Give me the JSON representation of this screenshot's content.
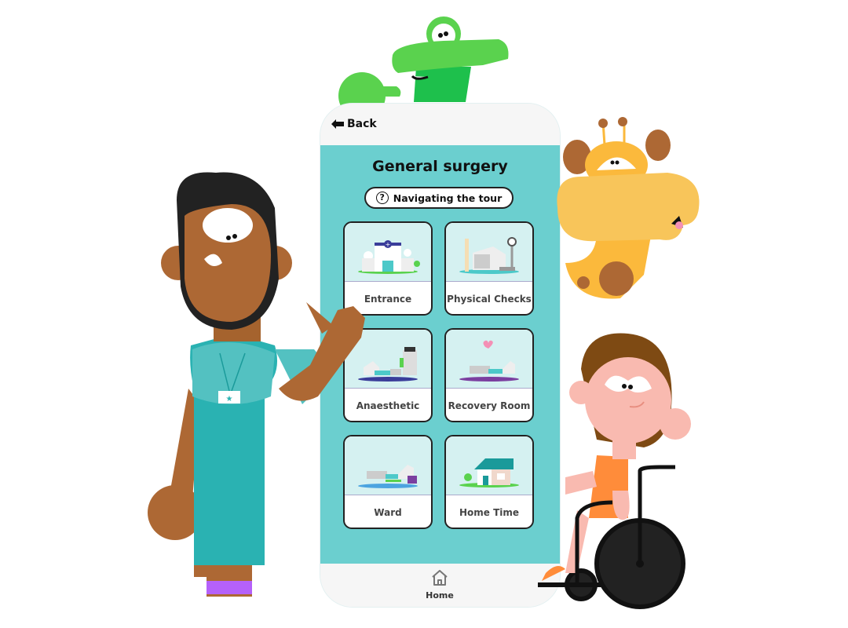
{
  "header": {
    "back_label": "Back",
    "back_icon": "arrow-left-icon"
  },
  "page": {
    "title": "General surgery",
    "tour_button": {
      "label": "Navigating the tour",
      "icon": "question-circle-icon"
    }
  },
  "cards": [
    {
      "label": "Entrance",
      "icon": "hospital-building-icon"
    },
    {
      "label": "Physical Checks",
      "icon": "scale-bed-icon"
    },
    {
      "label": "Anaesthetic",
      "icon": "anaesthetic-machine-icon"
    },
    {
      "label": "Recovery Room",
      "icon": "recovery-bed-heart-icon"
    },
    {
      "label": "Ward",
      "icon": "ward-bed-icon"
    },
    {
      "label": "Home Time",
      "icon": "house-icon"
    }
  ],
  "bottom_nav": {
    "home_label": "Home",
    "home_icon": "home-icon"
  },
  "colors": {
    "accent_teal": "#6bcfcf",
    "card_thumb": "#d5f1f1",
    "frog_green": "#5ad24e",
    "giraffe_yellow": "#f8c55a",
    "nurse_scrubs": "#2ab2b2",
    "child_shirt": "#ff8c3a"
  },
  "illustrations": [
    "frog-character",
    "giraffe-character",
    "nurse-character",
    "child-in-wheelchair-character"
  ]
}
